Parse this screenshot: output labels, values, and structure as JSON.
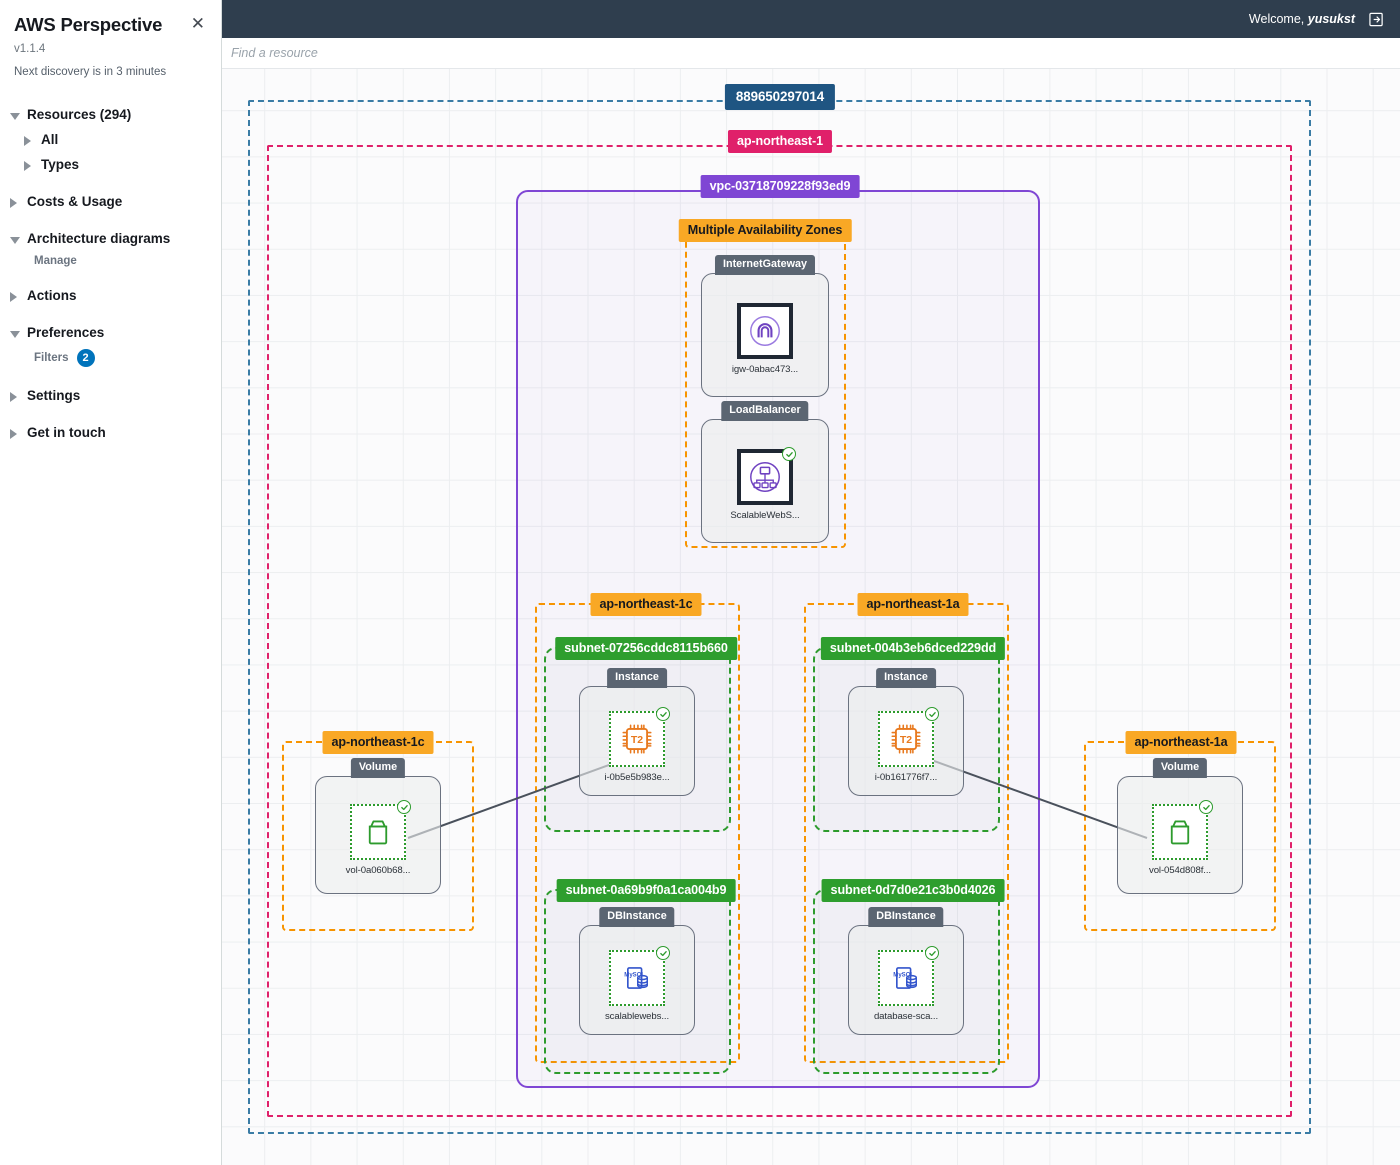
{
  "app": {
    "title": "AWS Perspective",
    "version": "v1.1.4",
    "discovery": "Next discovery is in 3 minutes",
    "close_icon": "close-icon"
  },
  "sidebar": {
    "items": [
      {
        "label": "Resources (294)",
        "state": "expanded",
        "level": 1,
        "children": [
          {
            "label": "All",
            "state": "collapsed",
            "level": 2
          },
          {
            "label": "Types",
            "state": "collapsed",
            "level": 2
          }
        ]
      },
      {
        "label": "Costs & Usage",
        "state": "collapsed",
        "level": 1,
        "children": []
      },
      {
        "label": "Architecture diagrams",
        "state": "expanded",
        "level": 1,
        "children": [
          {
            "label": "Manage",
            "state": "leaf",
            "level": 2
          }
        ]
      },
      {
        "label": "Actions",
        "state": "collapsed",
        "level": 1,
        "children": []
      },
      {
        "label": "Preferences",
        "state": "expanded",
        "level": 1,
        "children": [
          {
            "label": "Filters",
            "state": "leaf",
            "level": 2,
            "badge": "2"
          }
        ]
      },
      {
        "label": "Settings",
        "state": "collapsed",
        "level": 1,
        "children": []
      },
      {
        "label": "Get in touch",
        "state": "collapsed",
        "level": 1,
        "children": []
      }
    ]
  },
  "topbar": {
    "welcome_prefix": "Welcome,",
    "username": "yusukst",
    "logout_icon": "logout-icon"
  },
  "search": {
    "placeholder": "Find a resource",
    "value": ""
  },
  "colors": {
    "account": "#1f5582",
    "account_border": "#3a7ca5",
    "region": "#e0206a",
    "vpc": "#7f46d4",
    "az": "#f9a825",
    "az_border": "#f79400",
    "subnet": "#2e9e2e",
    "node_type_chip": "#5b6572",
    "edge": "#4a515c",
    "topbar": "#2f3e4e",
    "badge": "#0073bb"
  },
  "diagram": {
    "account_label": "889650297014",
    "region_label": "ap-northeast-1",
    "vpc_label": "vpc-03718709228f93ed9",
    "multi_az_label": "Multiple Availability Zones",
    "az_left_label": "ap-northeast-1c",
    "az_right_label": "ap-northeast-1a",
    "az_volume_left_label": "ap-northeast-1c",
    "az_volume_right_label": "ap-northeast-1a",
    "subnets": {
      "instance_left": "subnet-07256cddc8115b660",
      "instance_right": "subnet-004b3eb6dced229dd",
      "db_left": "subnet-0a69b9f0a1ca004b9",
      "db_right": "subnet-0d7d0e21c3b0d4026"
    },
    "nodes": [
      {
        "id": "igw",
        "type": "InternetGateway",
        "label": "igw-0abac473...",
        "icon": "internet-gateway-icon",
        "status": false
      },
      {
        "id": "elb",
        "type": "LoadBalancer",
        "label": "ScalableWebS...",
        "icon": "load-balancer-icon",
        "status": true
      },
      {
        "id": "ec2-left",
        "type": "Instance",
        "label": "i-0b5e5b983e...",
        "icon": "ec2-t2-icon",
        "status": true
      },
      {
        "id": "ec2-right",
        "type": "Instance",
        "label": "i-0b161776f7...",
        "icon": "ec2-t2-icon",
        "status": true
      },
      {
        "id": "vol-left",
        "type": "Volume",
        "label": "vol-0a060b68...",
        "icon": "ebs-volume-icon",
        "status": true
      },
      {
        "id": "vol-right",
        "type": "Volume",
        "label": "vol-054d808f...",
        "icon": "ebs-volume-icon",
        "status": true
      },
      {
        "id": "db-left",
        "type": "DBInstance",
        "label": "scalablewebs...",
        "icon": "mysql-db-icon",
        "status": true
      },
      {
        "id": "db-right",
        "type": "DBInstance",
        "label": "database-sca...",
        "icon": "mysql-db-icon",
        "status": true
      }
    ],
    "edges": [
      {
        "from": "ec2-left",
        "to": "vol-left"
      },
      {
        "from": "ec2-right",
        "to": "vol-right"
      }
    ]
  }
}
